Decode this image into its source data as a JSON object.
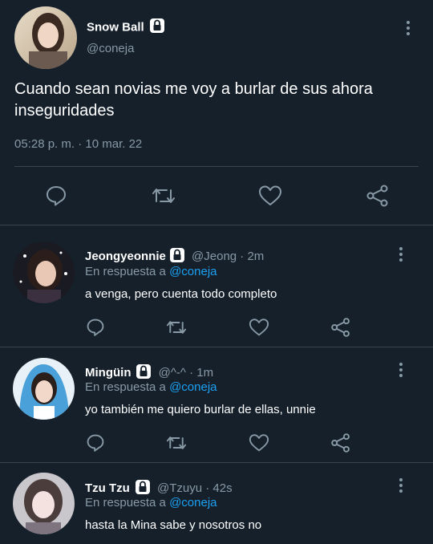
{
  "main_tweet": {
    "display_name": "Snow Ball",
    "handle": "@coneja",
    "text": "Cuando sean novias me voy a burlar de sus ahora inseguridades",
    "timestamp": "05:28 p. m. · 10 mar. 22"
  },
  "replies": [
    {
      "display_name": "Jeongyeonnie",
      "handle_time": "@Jeong · 2m",
      "reply_prefix": "En respuesta a",
      "reply_to": "@coneja",
      "text": "a venga, pero cuenta todo completo"
    },
    {
      "display_name": "Mingüin",
      "handle_time": "@^-^ · 1m",
      "reply_prefix": "En respuesta a",
      "reply_to": "@coneja",
      "text": "yo también me quiero burlar de ellas, unnie"
    },
    {
      "display_name": "Tzu Tzu",
      "handle_time": "@Tzuyu · 42s",
      "reply_prefix": "En respuesta a",
      "reply_to": "@coneja",
      "text": "hasta la Mina sabe y nosotros no"
    }
  ],
  "icons": [
    "lock-icon",
    "more-icon",
    "reply-icon",
    "retweet-icon",
    "like-icon",
    "share-icon"
  ],
  "colors": {
    "background": "#15202b",
    "text": "#ffffff",
    "muted": "#8899a6",
    "link": "#1da1f2",
    "divider": "#38444d"
  }
}
